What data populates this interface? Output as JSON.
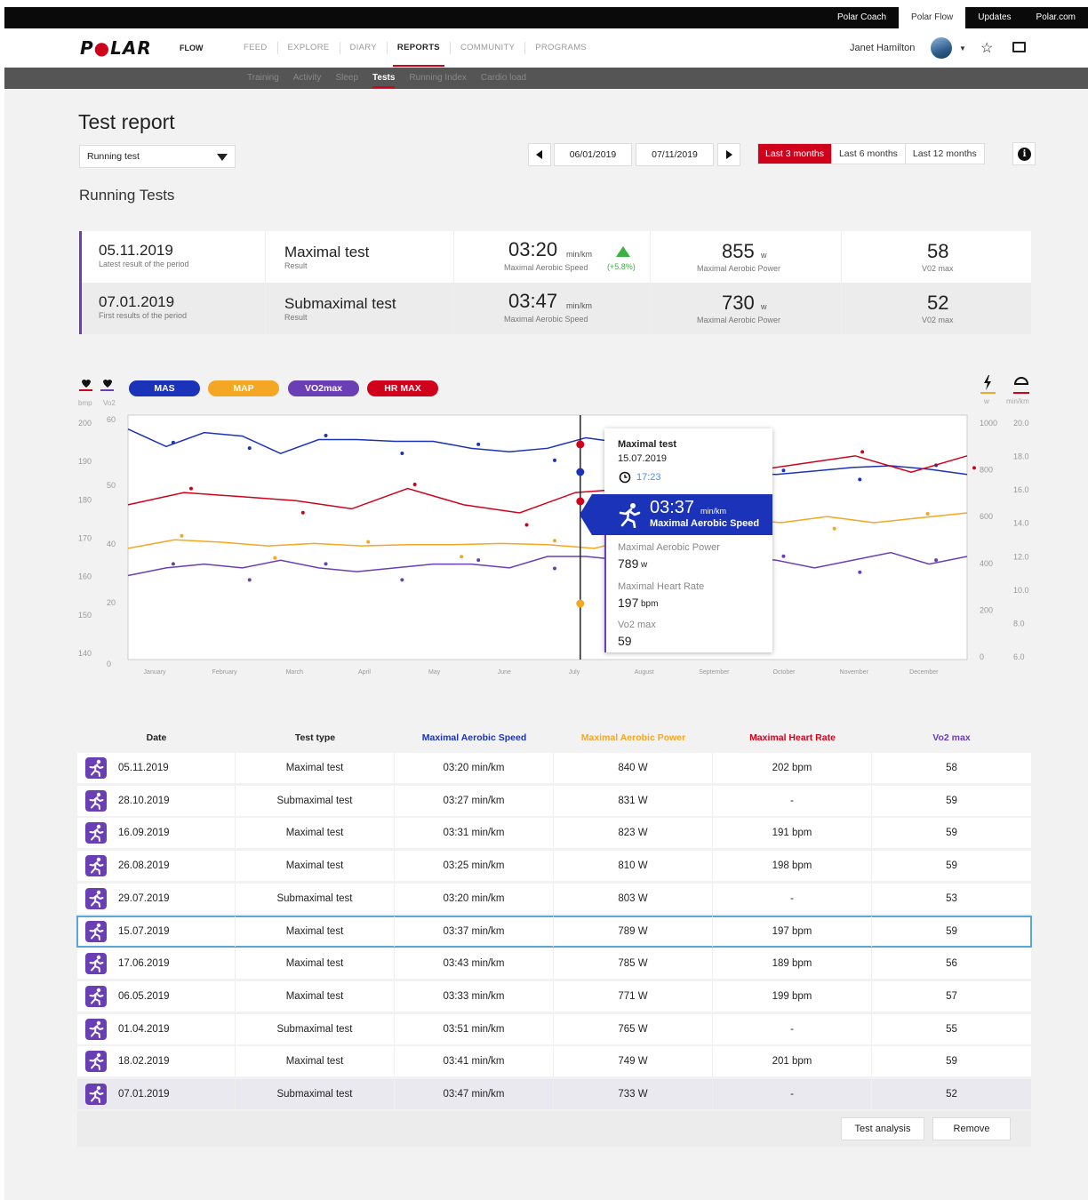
{
  "top_links": [
    {
      "label": "Polar Coach",
      "active": false
    },
    {
      "label": "Polar Flow",
      "active": true
    },
    {
      "label": "Updates",
      "active": false
    },
    {
      "label": "Polar.com",
      "active": false
    }
  ],
  "nav": {
    "logo": "POLAR",
    "logo_dot": "●",
    "app": "FLOW",
    "items": [
      "FEED",
      "EXPLORE",
      "DIARY",
      "REPORTS",
      "COMMUNITY",
      "PROGRAMS"
    ],
    "active": "REPORTS",
    "user": "Janet Hamilton"
  },
  "subnav": {
    "items": [
      "Training",
      "Activity",
      "Sleep",
      "Tests",
      "Running Index",
      "Cardio load"
    ],
    "active": "Tests"
  },
  "page": {
    "title": "Test report",
    "test_select": "Running test",
    "start_date": "06/01/2019",
    "end_date": "07/11/2019",
    "periods": [
      "Last 3 months",
      "Last 6 months",
      "Last 12 months"
    ],
    "active_period": "Last 3 months",
    "info": "i",
    "section_title": "Running Tests"
  },
  "summary": [
    {
      "date": "05.11.2019",
      "date_note": "Latest result of the period",
      "type": "Maximal test",
      "type_note": "Result",
      "mas": "03:20",
      "mas_unit": "min/km",
      "mas_label": "Maximal Aerobic Speed",
      "mas_change": "(+5.8%)",
      "map": "855",
      "map_unit": "w",
      "map_label": "Maximal Aerobic Power",
      "vo2": "58",
      "vo2_label": "V02 max"
    },
    {
      "date": "07.01.2019",
      "date_note": "First results of the period",
      "type": "Submaximal test",
      "type_note": "Result",
      "mas": "03:47",
      "mas_unit": "min/km",
      "mas_label": "Maximal Aerobic Speed",
      "map": "730",
      "map_unit": "w",
      "map_label": "Maximal Aerobic Power",
      "vo2": "52",
      "vo2_label": "V02 max"
    }
  ],
  "legend": {
    "left_units": [
      "bmp",
      "Vo2"
    ],
    "right_units": [
      "w",
      "min/km"
    ],
    "pills": [
      {
        "label": "MAS",
        "color": "#1b33b8"
      },
      {
        "label": "MAP",
        "color": "#f5a623"
      },
      {
        "label": "VO2max",
        "color": "#6a3fb5"
      },
      {
        "label": "HR MAX",
        "color": "#d0021b"
      }
    ]
  },
  "chart_data": {
    "type": "line",
    "categories": [
      "January",
      "February",
      "March",
      "April",
      "May",
      "June",
      "July",
      "August",
      "September",
      "October",
      "November",
      "December"
    ],
    "axes": {
      "left_hr": {
        "ticks": [
          "200",
          "190",
          "180",
          "170",
          "160",
          "150",
          "140"
        ],
        "range": [
          140,
          200
        ]
      },
      "left_vo2": {
        "ticks": [
          "60",
          "50",
          "40",
          "20",
          "0"
        ]
      },
      "right_w": {
        "ticks": [
          "1000",
          "800",
          "600",
          "400",
          "200",
          "0"
        ],
        "range": [
          0,
          1000
        ]
      },
      "right_pace": {
        "ticks": [
          "20.0",
          "18.0",
          "16.0",
          "14.0",
          "12.0",
          "10.0",
          "8.0",
          "6.0"
        ],
        "range": [
          6,
          20
        ]
      }
    },
    "series": [
      {
        "name": "MAS",
        "color": "#1b33b8",
        "values": [
          19.2,
          18.2,
          19.0,
          18.8,
          17.8,
          18.6,
          18.6,
          18.5,
          18.5,
          18.1,
          17.9,
          18.1,
          18.7,
          18.4,
          18.3,
          16.5,
          16.7,
          16.6,
          16.8,
          17.0,
          17.1,
          16.9,
          16.6
        ]
      },
      {
        "name": "MAP",
        "color": "#f5a623",
        "values": [
          455,
          490,
          480,
          465,
          475,
          465,
          470,
          470,
          475,
          470,
          455,
          500,
          500,
          580,
          560,
          585,
          560,
          580,
          600
        ]
      },
      {
        "name": "VO2max",
        "color": "#6a3fb5",
        "values": [
          22,
          24,
          25,
          24,
          26,
          24,
          23,
          24,
          25,
          25,
          24,
          27,
          27,
          26,
          24,
          22,
          27,
          26,
          24,
          26,
          28,
          25,
          27
        ]
      },
      {
        "name": "HR MAX",
        "color": "#d0021b",
        "values": [
          178,
          181,
          180,
          179,
          177,
          182,
          178,
          176,
          181,
          182,
          183,
          186,
          188,
          190,
          186,
          190
        ]
      }
    ],
    "grid": false,
    "legend": "top-left"
  },
  "tooltip": {
    "title": "Maximal test",
    "date": "15.07.2019",
    "time": "17:23",
    "highlight_value": "03:37",
    "highlight_unit": "min/km",
    "highlight_label": "Maximal Aerobic Speed",
    "rows": [
      {
        "label": "Maximal Aerobic Power",
        "value": "789",
        "unit": "w"
      },
      {
        "label": "Maximal Heart Rate",
        "value": "197",
        "unit": "bpm"
      },
      {
        "label": "Vo2 max",
        "value": "59",
        "unit": ""
      }
    ]
  },
  "table": {
    "headers": [
      {
        "label": "Date",
        "color": "#222"
      },
      {
        "label": "Test type",
        "color": "#222"
      },
      {
        "label": "Maximal Aerobic Speed",
        "color": "#1b33b8"
      },
      {
        "label": "Maximal Aerobic Power",
        "color": "#f5a623"
      },
      {
        "label": "Maximal Heart Rate",
        "color": "#d0021b"
      },
      {
        "label": "Vo2 max",
        "color": "#6a3fb5"
      }
    ],
    "rows": [
      [
        "05.11.2019",
        "Maximal test",
        "03:20 min/km",
        "840 W",
        "202 bpm",
        "58"
      ],
      [
        "28.10.2019",
        "Submaximal test",
        "03:27 min/km",
        "831 W",
        "-",
        "59"
      ],
      [
        "16.09.2019",
        "Maximal test",
        "03:31 min/km",
        "823 W",
        "191 bpm",
        "59"
      ],
      [
        "26.08.2019",
        "Maximal test",
        "03:25 min/km",
        "810 W",
        "198 bpm",
        "59"
      ],
      [
        "29.07.2019",
        "Submaximal test",
        "03:20 min/km",
        "803 W",
        "-",
        "53"
      ],
      [
        "15.07.2019",
        "Maximal test",
        "03:37 min/km",
        "789 W",
        "197 bpm",
        "59"
      ],
      [
        "17.06.2019",
        "Maximal test",
        "03:43 min/km",
        "785 W",
        "189 bpm",
        "56"
      ],
      [
        "06.05.2019",
        "Maximal test",
        "03:33 min/km",
        "771 W",
        "199 bpm",
        "57"
      ],
      [
        "01.04.2019",
        "Submaximal test",
        "03:51 min/km",
        "765 W",
        "-",
        "55"
      ],
      [
        "18.02.2019",
        "Maximal test",
        "03:41 min/km",
        "749 W",
        "201 bpm",
        "59"
      ],
      [
        "07.01.2019",
        "Submaximal test",
        "03:47 min/km",
        "733 W",
        "-",
        "52"
      ]
    ],
    "selected_row": 5,
    "actions": [
      "Test analysis",
      "Remove"
    ]
  }
}
